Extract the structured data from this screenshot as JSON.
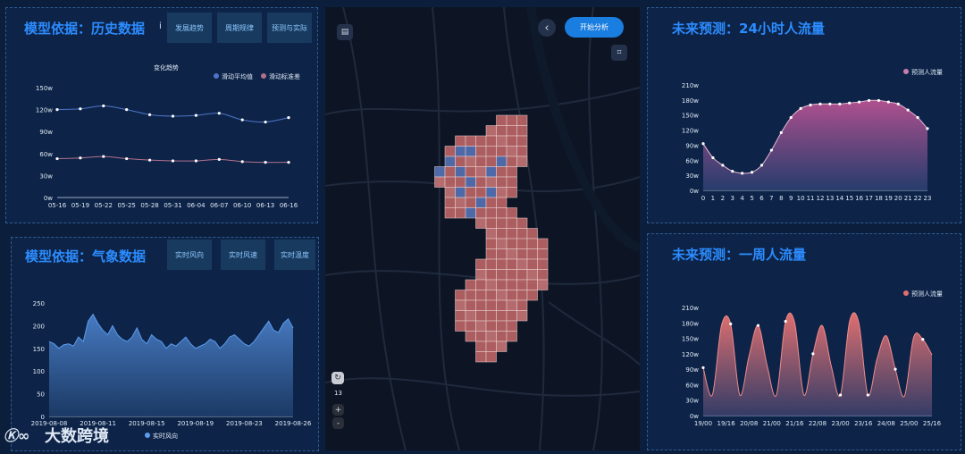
{
  "panels": {
    "history": {
      "title": "模型依据：历史数据",
      "info_icon": "i",
      "tabs": [
        "发展趋势",
        "周期规律",
        "预测与实际"
      ]
    },
    "weather": {
      "title": "模型依据：气象数据",
      "tabs": [
        "实时风向",
        "实时风速",
        "实时温度"
      ]
    },
    "forecast24": {
      "title": "未来预测：24小时人流量"
    },
    "forecastWeek": {
      "title": "未来预测：一周人流量"
    }
  },
  "map": {
    "analyze_label": "开始分析",
    "zoom_level": "13",
    "zoom_in": "+",
    "zoom_out": "-",
    "back_icon": "‹"
  },
  "watermark": "大数跨境",
  "colors": {
    "accent": "#2c8cff",
    "line_blue": "#4f74c8",
    "line_pink": "#b3708e",
    "area_pink": "#b0508f",
    "area_red": "#e07070",
    "weather_line": "#5b9cf0"
  },
  "chart_data": [
    {
      "type": "line",
      "title": "变化趋势",
      "categories": [
        "05-16",
        "05-19",
        "05-22",
        "05-25",
        "05-28",
        "05-31",
        "06-04",
        "06-07",
        "06-10",
        "06-13",
        "06-16"
      ],
      "series": [
        {
          "name": "滑动平均值",
          "values": [
            120,
            121,
            125,
            120,
            113,
            111,
            112,
            115,
            106,
            103,
            109
          ]
        },
        {
          "name": "滑动标准差",
          "values": [
            53,
            54,
            56,
            53,
            51,
            50,
            50,
            52,
            49,
            48,
            48
          ]
        }
      ],
      "ylim": [
        0,
        150
      ],
      "yticks": [
        "0w",
        "30w",
        "60w",
        "90w",
        "120w",
        "150w"
      ],
      "legend": "top-right"
    },
    {
      "type": "area",
      "categories": [
        "2019-08-08",
        "2019-08-11",
        "2019-08-15",
        "2019-08-19",
        "2019-08-23",
        "2019-08-26"
      ],
      "series": [
        {
          "name": "实时风向",
          "values": [
            165,
            160,
            150,
            158,
            160,
            155,
            175,
            165,
            210,
            225,
            205,
            190,
            180,
            200,
            180,
            170,
            165,
            175,
            195,
            170,
            160,
            180,
            170,
            165,
            150,
            160,
            155,
            165,
            175,
            160,
            150,
            155,
            160,
            170,
            165,
            150,
            160,
            175,
            180,
            170,
            160,
            155,
            165,
            180,
            195,
            210,
            190,
            185,
            205,
            215,
            195
          ]
        }
      ],
      "ylim": [
        0,
        250
      ],
      "yticks": [
        "0",
        "50",
        "100",
        "150",
        "200",
        "250"
      ],
      "legend": "bottom"
    },
    {
      "type": "area",
      "categories": [
        "0",
        "1",
        "2",
        "3",
        "4",
        "5",
        "6",
        "7",
        "8",
        "9",
        "10",
        "11",
        "12",
        "13",
        "14",
        "15",
        "16",
        "17",
        "18",
        "19",
        "20",
        "21",
        "22",
        "23"
      ],
      "series": [
        {
          "name": "预测人流量",
          "values": [
            93,
            65,
            50,
            38,
            34,
            36,
            50,
            80,
            115,
            145,
            163,
            170,
            172,
            172,
            172,
            174,
            176,
            179,
            179,
            176,
            172,
            160,
            145,
            123
          ]
        }
      ],
      "ylim": [
        0,
        210
      ],
      "yticks": [
        "0w",
        "30w",
        "60w",
        "90w",
        "120w",
        "150w",
        "180w",
        "210w"
      ],
      "legend": "top-right"
    },
    {
      "type": "area",
      "categories": [
        "19/00",
        "19/16",
        "20/08",
        "21/00",
        "21/16",
        "22/08",
        "23/00",
        "23/16",
        "24/08",
        "25/00",
        "25/16"
      ],
      "series": [
        {
          "name": "预测人流量",
          "values": [
            93,
            40,
            175,
            178,
            40,
            115,
            175,
            96,
            40,
            183,
            180,
            40,
            120,
            175,
            96,
            40,
            183,
            181,
            40,
            110,
            155,
            90,
            38,
            152,
            148,
            118
          ]
        }
      ],
      "ylim": [
        0,
        210
      ],
      "yticks": [
        "0w",
        "30w",
        "60w",
        "90w",
        "120w",
        "150w",
        "180w",
        "210w"
      ],
      "legend": "top-right"
    }
  ]
}
